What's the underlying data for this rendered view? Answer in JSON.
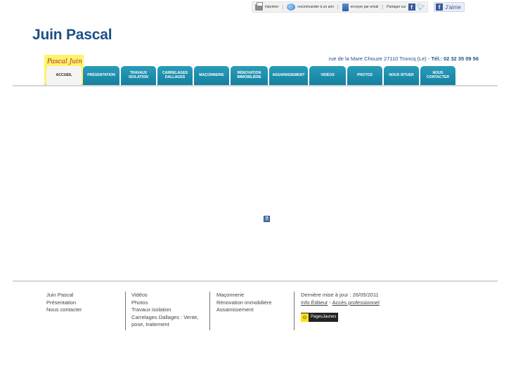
{
  "toolbar": {
    "print": "imprimer",
    "recommend": "recommander à un ami",
    "email": "envoyer par email",
    "share": "Partager sur",
    "like": "J'aime"
  },
  "site": {
    "title": "Juin Pascal",
    "address": "rue de la Mare Chouze 27110 Troncq (Le)",
    "separator": " - ",
    "phone": "Tél.: 02 32 35 09 56",
    "logo_text": "Pascal Juin"
  },
  "nav": [
    {
      "label": "ACCUEIL",
      "width": 50,
      "active": true
    },
    {
      "label": "PRÉSENTATION",
      "width": 52
    },
    {
      "label": "TRAVAUX ISOLATION",
      "width": 50
    },
    {
      "label": "CARRELAGES DALLAGES",
      "width": 50
    },
    {
      "label": "MAÇONNERIE",
      "width": 50
    },
    {
      "label": "RÉNOVATION IMMOBILIÈRE",
      "width": 53
    },
    {
      "label": "ASSAINISSEMENT",
      "width": 55
    },
    {
      "label": "VIDÉOS",
      "width": 52
    },
    {
      "label": "PHOTOS",
      "width": 50
    },
    {
      "label": "NOUS SITUER",
      "width": 50
    },
    {
      "label": "NOUS CONTACTER",
      "width": 50
    }
  ],
  "content": {
    "plugin_icon": "?"
  },
  "footer": {
    "col1": [
      "Juin Pascal",
      "Présentation",
      "Nous contacter"
    ],
    "col2": [
      "Vidéos",
      "Photos",
      "Travaux isolation",
      "Carrelages Dallages : Vente, pose, traitement"
    ],
    "col3": [
      "Maçonnerie",
      "Rénovation immobilière",
      "Assainissement"
    ],
    "last_update": "Dernière mise à jour : 26/05/2011",
    "info_editor": "Info Éditeur",
    "dash": " - ",
    "pro_access": "Accès professionnel",
    "pj_label": "PagesJaunes"
  }
}
